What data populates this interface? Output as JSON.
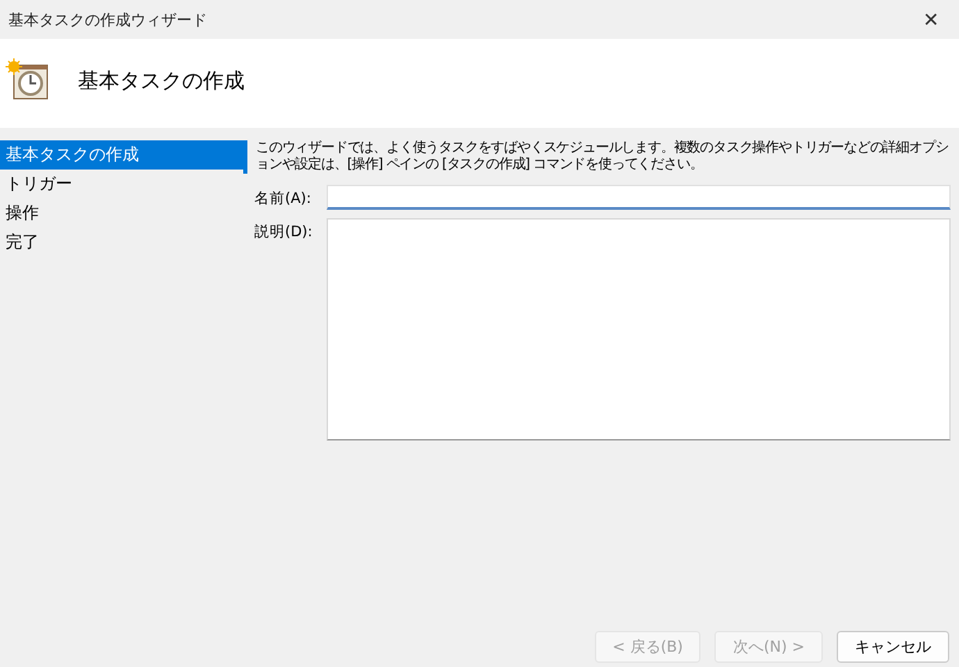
{
  "window": {
    "title": "基本タスクの作成ウィザード",
    "close": "✕"
  },
  "header": {
    "title": "基本タスクの作成"
  },
  "sidebar": {
    "items": [
      {
        "label": "基本タスクの作成",
        "selected": true
      },
      {
        "label": "トリガー",
        "selected": false
      },
      {
        "label": "操作",
        "selected": false
      },
      {
        "label": "完了",
        "selected": false
      }
    ]
  },
  "intro": "このウィザードでは、よく使うタスクをすばやくスケジュールします。複数のタスク操作やトリガーなどの詳細オプションや設定は、[操作] ペインの [タスクの作成] コマンドを使ってください。",
  "fields": [
    {
      "label": "名前(A):",
      "kind": "line",
      "focused": true
    },
    {
      "label": "説明(D):",
      "kind": "area",
      "focused": false
    }
  ],
  "buttons": [
    {
      "label": "< 戻る(B)",
      "disabled": true
    },
    {
      "label": "次へ(N) >",
      "disabled": true
    },
    {
      "label": "キャンセル",
      "disabled": false
    }
  ]
}
